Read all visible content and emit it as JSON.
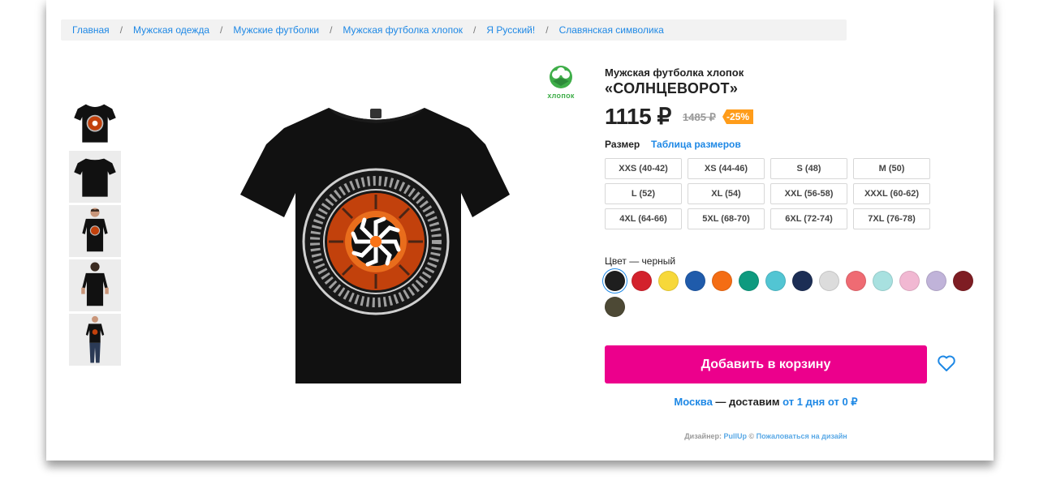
{
  "breadcrumbs": [
    "Главная",
    "Мужская одежда",
    "Мужские футболки",
    "Мужская футболка хлопок",
    "Я Русский!",
    "Славянская символика"
  ],
  "badge": {
    "label": "хлопок",
    "icon": "cotton-icon"
  },
  "product": {
    "category": "Мужская футболка хлопок",
    "name": "«СОЛНЦЕВОРОТ»",
    "price": "1115 ₽",
    "old_price": "1485 ₽",
    "discount": "-25%"
  },
  "size_section": {
    "label": "Размер",
    "table_link": "Таблица размеров",
    "sizes": [
      "XXS (40-42)",
      "XS (44-46)",
      "S (48)",
      "M (50)",
      "L (52)",
      "XL (54)",
      "XXL (56-58)",
      "XXXL (60-62)",
      "4XL (64-66)",
      "5XL (68-70)",
      "6XL (72-74)",
      "7XL (76-78)"
    ]
  },
  "color_section": {
    "label": "Цвет — черный",
    "colors": [
      "#1e1e1e",
      "#d3212c",
      "#f7d839",
      "#1f5bab",
      "#f46d14",
      "#0e9a7f",
      "#52c5d3",
      "#1c2e55",
      "#dcdcdc",
      "#ef6b73",
      "#a8e1e0",
      "#f1b8d2",
      "#c0b3d9",
      "#7e1d23",
      "#4d4935"
    ],
    "selected_index": 0
  },
  "cart_button": "Добавить в корзину",
  "delivery": {
    "city": "Москва",
    "middle": " — доставим ",
    "rest": "от 1 дня от 0 ₽"
  },
  "designer": {
    "prefix": "Дизайнер: ",
    "name": "PullUp",
    "sep": " © ",
    "report": "Пожаловаться на дизайн"
  },
  "accent_colors": {
    "link": "#1e88e5",
    "cart": "#ec008c",
    "discount": "#ff9c1a",
    "cotton": "#3fae49"
  }
}
